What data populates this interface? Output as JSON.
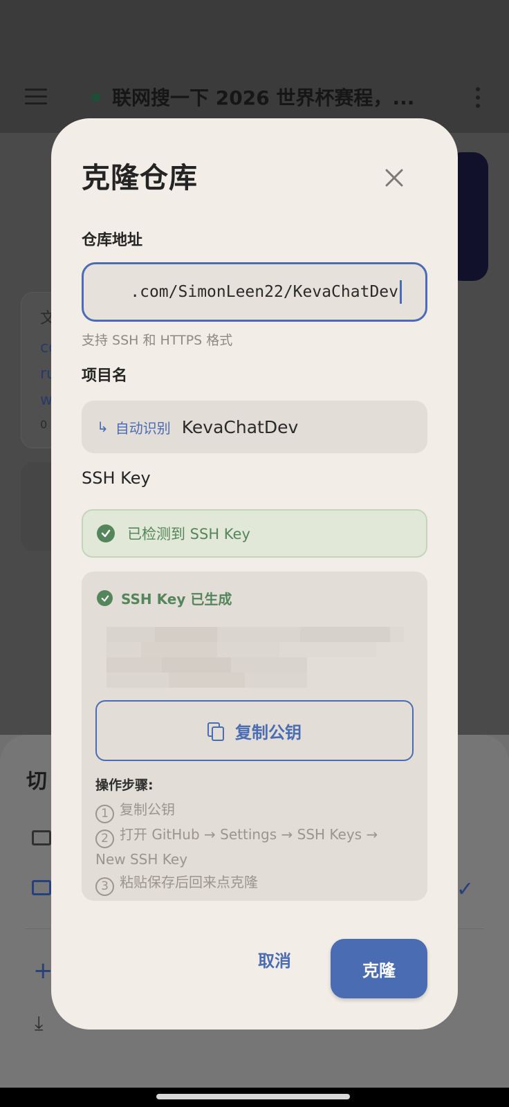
{
  "background": {
    "chat_title": "联网搜一下 2026 世界杯赛程，...",
    "sheet_title": "切",
    "card_fragments": [
      "文",
      "co",
      "ru",
      "w",
      "0"
    ]
  },
  "dialog": {
    "title": "克隆仓库",
    "repo": {
      "label": "仓库地址",
      "value": ".com/SimonLeen22/KevaChatDev",
      "hint": "支持 SSH 和 HTTPS 格式"
    },
    "project": {
      "label": "项目名",
      "auto_label": "自动识别",
      "value": "KevaChatDev"
    },
    "ssh": {
      "label": "SSH Key",
      "detected": "已检测到 SSH Key",
      "generated": "SSH Key 已生成",
      "copy_button": "复制公钥",
      "steps_title": "操作步骤:",
      "steps": [
        {
          "num": "1",
          "text": "复制公钥"
        },
        {
          "num": "2",
          "text": "打开 GitHub → Settings → SSH Keys → New SSH Key"
        },
        {
          "num": "3",
          "text": "粘贴保存后回来点克隆"
        }
      ]
    },
    "cancel_button": "取消",
    "clone_button": "克隆"
  },
  "colors": {
    "accent": "#4a6cb3",
    "success": "#55855b",
    "dialog_bg": "#f2eee7"
  }
}
